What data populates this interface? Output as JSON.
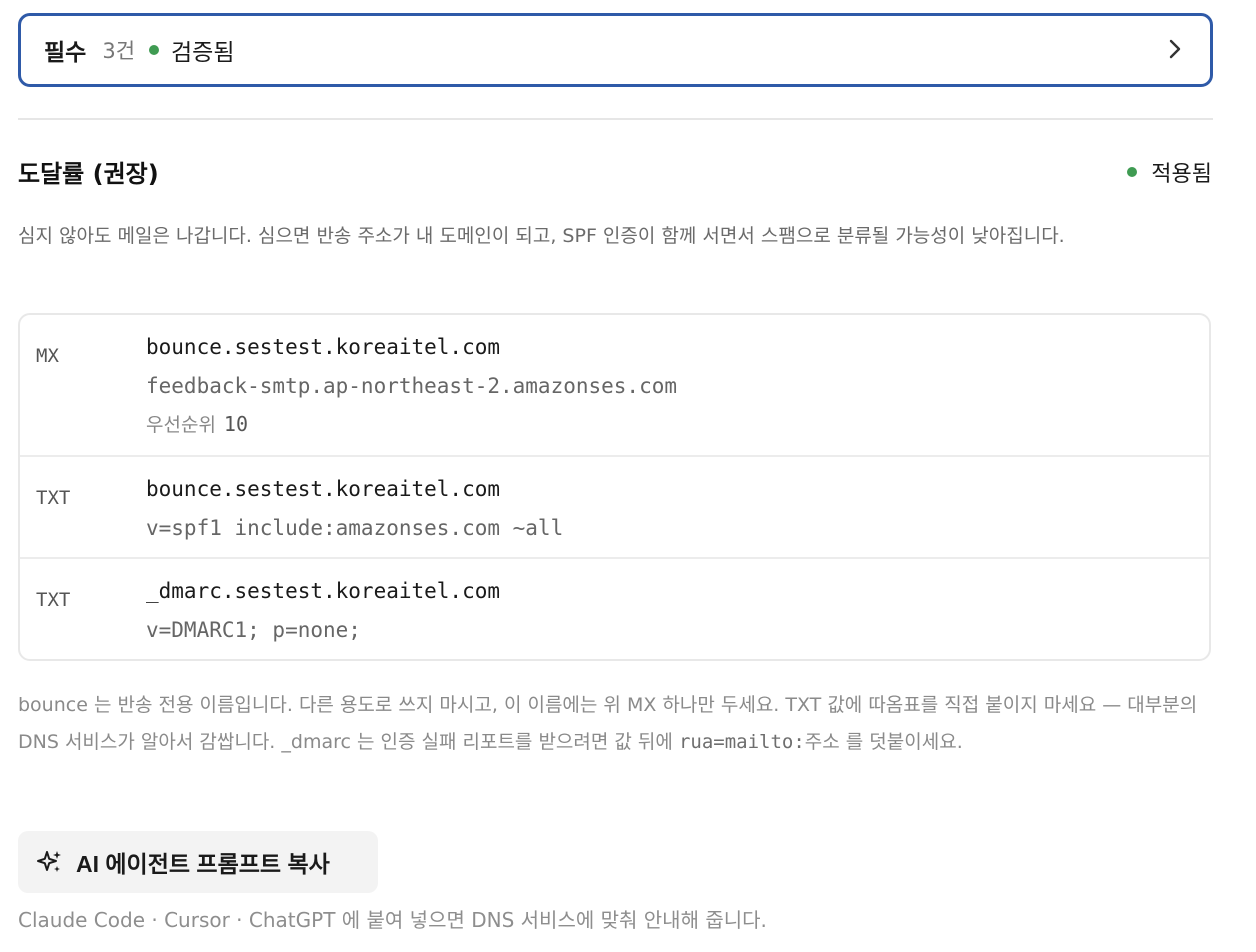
{
  "required": {
    "title": "필수",
    "count": "3건",
    "status": "검증됨",
    "status_color": "#3f9b52",
    "chevron_icon": "chevron-right-icon"
  },
  "deliverability": {
    "title": "도달률 (권장)",
    "status": "적용됨",
    "status_color": "#3f9b52",
    "description": "심지 않아도 메일은 나갑니다. 심으면 반송 주소가 내 도메인이 되고, SPF 인증이 함께 서면서 스팸으로 분류될 가능성이 낮아집니다."
  },
  "records": [
    {
      "type": "MX",
      "name": "bounce.sestest.koreaitel.com",
      "value": "feedback-smtp.ap-northeast-2.amazonses.com",
      "priority_label": "우선순위",
      "priority": "10"
    },
    {
      "type": "TXT",
      "name": "bounce.sestest.koreaitel.com",
      "value": "v=spf1 include:amazonses.com ~all"
    },
    {
      "type": "TXT",
      "name": "_dmarc.sestest.koreaitel.com",
      "value": "v=DMARC1; p=none;"
    }
  ],
  "note": {
    "part1": "bounce 는 반송 전용 이름입니다. 다른 용도로 쓰지 마시고, 이 이름에는 위 MX 하나만 두세요. TXT 값에 따옴표를 직접 붙이지 마세요 — 대부분의 DNS 서비스가 알아서 감쌉니다. _dmarc 는 인증 실패 리포트를 받으려면 값 뒤에 ",
    "code": "rua=mailto:",
    "part2": "주소 를 덧붙이세요."
  },
  "ai_button": {
    "icon": "sparkles-icon",
    "label": "AI 에이전트 프롬프트 복사"
  },
  "footnote": "Claude Code · Cursor · ChatGPT 에 붙여 넣으면 DNS 서비스에 맞춰 안내해 줍니다."
}
